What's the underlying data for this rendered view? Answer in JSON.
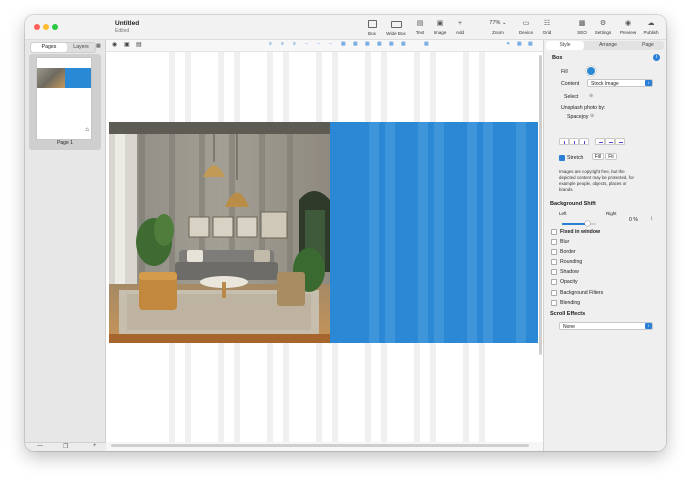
{
  "window": {
    "title": "Untitled",
    "status": "Edited"
  },
  "toolbar": {
    "box": "Box",
    "widebox": "Wide Box",
    "text": "Text",
    "image": "Image",
    "add": "Add",
    "zoom_value": "77%",
    "zoom": "Zoom",
    "device": "Device",
    "grid": "Grid",
    "seo": "SEO",
    "settings": "Settings",
    "preview": "Preview",
    "publish": "Publish"
  },
  "sidebar": {
    "tab_pages": "Pages",
    "tab_layers": "Layers",
    "page_label": "Page 1"
  },
  "inspector": {
    "tabs": {
      "style": "Style",
      "arrange": "Arrange",
      "page": "Page"
    },
    "box_heading": "Box",
    "fill_label": "Fill",
    "content_label": "Content",
    "content_value": "Stock Image",
    "select_label": "Select",
    "unsplash": "Unsplash photo by:",
    "photographer": "Spacejoy",
    "stretch": "Stretch",
    "fill_btn": "Fill",
    "fit_btn": "Fit",
    "copyright": [
      "Images are copyright free, but the",
      "depicted content may be protected, for",
      "example people, objects, places or",
      "brands."
    ],
    "bg_shift": "Background Shift",
    "left": "Left",
    "right": "Right",
    "shift_value": "0 %",
    "shift_fraction": 0.75,
    "fixed": "Fixed in window",
    "effects": [
      "Blur",
      "Border",
      "Rounding",
      "Shadow",
      "Opacity",
      "Background Filters",
      "Blending"
    ],
    "scroll_effects": "Scroll Effects",
    "scroll_value": "None"
  },
  "colors": {
    "accent": "#2b7fd6",
    "box_fill": "#2b88d5"
  }
}
